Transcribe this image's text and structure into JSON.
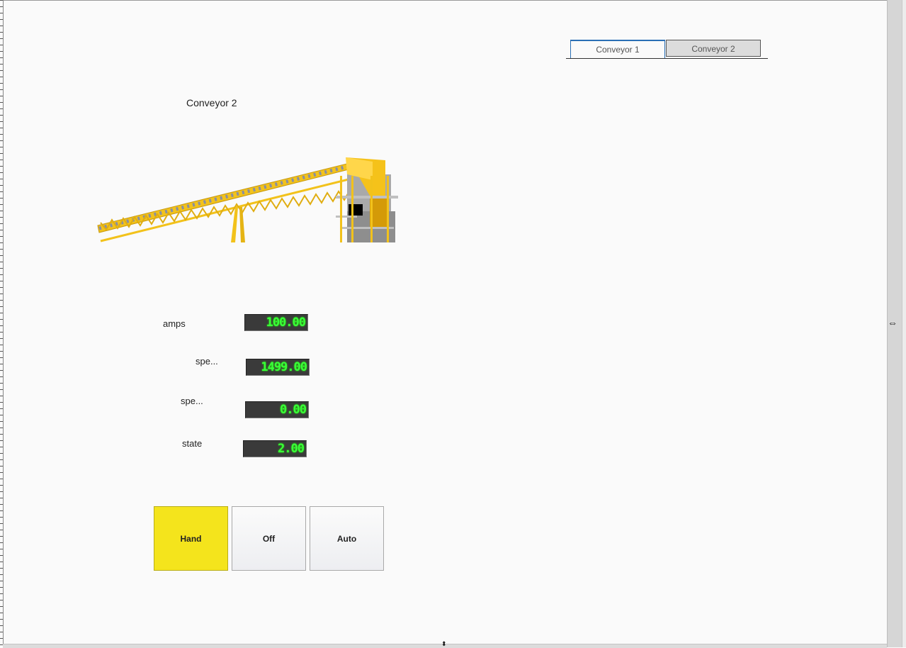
{
  "tabs": [
    {
      "label": "Conveyor 1",
      "active": true
    },
    {
      "label": "Conveyor 2",
      "active": false
    }
  ],
  "panel": {
    "title": "Conveyor 2",
    "image": "conveyor-belt-illustration"
  },
  "readouts": [
    {
      "label": "amps",
      "value": "100.00"
    },
    {
      "label": "spe...",
      "value": "1499.00"
    },
    {
      "label": "spe...",
      "value": "0.00"
    },
    {
      "label": "state",
      "value": "2.00"
    }
  ],
  "mode_buttons": [
    {
      "label": "Hand",
      "selected": true
    },
    {
      "label": "Off",
      "selected": false
    },
    {
      "label": "Auto",
      "selected": false
    }
  ],
  "colors": {
    "selected_button": "#f4e41c",
    "lcd_text": "#39ff39",
    "lcd_background": "#3a3a3a",
    "conveyor_frame": "#f2c21b"
  },
  "icons": {
    "resize_horizontal": "⇔",
    "resize_vertical": "⬍"
  }
}
